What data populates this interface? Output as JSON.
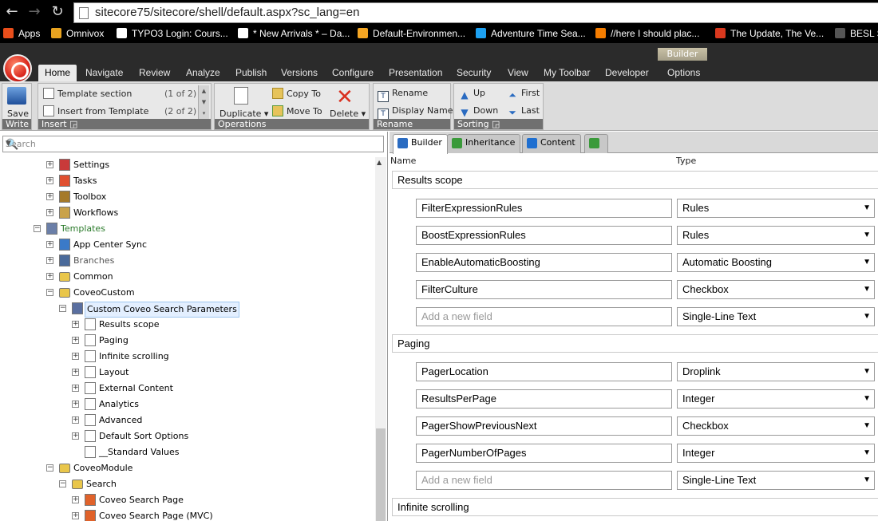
{
  "browser": {
    "url": "sitecore75/sitecore/shell/default.aspx?sc_lang=en",
    "bookmarks": [
      {
        "label": "Apps",
        "color": "#e94e1b"
      },
      {
        "label": "Omnivox",
        "color": "#e8a320"
      },
      {
        "label": "TYPO3 Login: Cours...",
        "color": "#ffffff"
      },
      {
        "label": "* New Arrivals * – Da...",
        "color": "#ffffff"
      },
      {
        "label": "Default-Environmen...",
        "color": "#f5a623"
      },
      {
        "label": "Adventure Time Sea...",
        "color": "#1da1f2"
      },
      {
        "label": "//here I should plac...",
        "color": "#f57d00"
      },
      {
        "label": "The Update, The Ve...",
        "color": "#d9381e"
      },
      {
        "label": "BESL S",
        "color": "#555555"
      }
    ]
  },
  "ribbon": {
    "context_tab": "Builder",
    "tabs": [
      "Home",
      "Navigate",
      "Review",
      "Analyze",
      "Publish",
      "Versions",
      "Configure",
      "Presentation",
      "Security",
      "View",
      "My Toolbar",
      "Developer",
      "Options"
    ],
    "groups": {
      "write": {
        "label": "Write",
        "save": "Save"
      },
      "insert": {
        "label": "Insert",
        "items": [
          {
            "label": "Template section",
            "count": "(1 of 2)"
          },
          {
            "label": "Insert from Template",
            "count": "(2 of 2)"
          }
        ]
      },
      "operations": {
        "label": "Operations",
        "duplicate": "Duplicate",
        "copy_to": "Copy To",
        "move_to": "Move To",
        "delete": "Delete"
      },
      "rename": {
        "label": "Rename",
        "rename": "Rename",
        "display_name": "Display Name"
      },
      "sorting": {
        "label": "Sorting",
        "up": "Up",
        "down": "Down",
        "first": "First",
        "last": "Last"
      }
    }
  },
  "tree": {
    "search_placeholder": "Search",
    "items": [
      {
        "label": "Settings",
        "level": 0,
        "expander": "+",
        "icon": "settings-icon"
      },
      {
        "label": "Tasks",
        "level": 0,
        "expander": "+",
        "icon": "tasks-icon"
      },
      {
        "label": "Toolbox",
        "level": 0,
        "expander": "+",
        "icon": "toolbox-icon"
      },
      {
        "label": "Workflows",
        "level": 0,
        "expander": "+",
        "icon": "workflows-icon"
      },
      {
        "label": "Templates",
        "level": -1,
        "expander": "−",
        "icon": "templates-icon"
      },
      {
        "label": "App Center Sync",
        "level": 0,
        "expander": "+",
        "icon": "sync-icon"
      },
      {
        "label": "Branches",
        "level": 0,
        "expander": "+",
        "icon": "branches-icon"
      },
      {
        "label": "Common",
        "level": 0,
        "expander": "+",
        "icon": "folder-icon"
      },
      {
        "label": "CoveoCustom",
        "level": 0,
        "expander": "−",
        "icon": "folder-icon"
      },
      {
        "label": "Custom Coveo Search Parameters",
        "level": 1,
        "expander": "−",
        "icon": "template-icon",
        "selected": true
      },
      {
        "label": "Results scope",
        "level": 2,
        "expander": "+",
        "icon": "section-icon"
      },
      {
        "label": "Paging",
        "level": 2,
        "expander": "+",
        "icon": "section-icon"
      },
      {
        "label": "Infinite scrolling",
        "level": 2,
        "expander": "+",
        "icon": "section-icon"
      },
      {
        "label": "Layout",
        "level": 2,
        "expander": "+",
        "icon": "section-icon"
      },
      {
        "label": "External Content",
        "level": 2,
        "expander": "+",
        "icon": "section-icon"
      },
      {
        "label": "Analytics",
        "level": 2,
        "expander": "+",
        "icon": "section-icon"
      },
      {
        "label": "Advanced",
        "level": 2,
        "expander": "+",
        "icon": "section-icon"
      },
      {
        "label": "Default Sort Options",
        "level": 2,
        "expander": "+",
        "icon": "section-icon"
      },
      {
        "label": "__Standard Values",
        "level": 2,
        "expander": "",
        "icon": "section-icon"
      },
      {
        "label": "CoveoModule",
        "level": 0,
        "expander": "−",
        "icon": "folder-icon"
      },
      {
        "label": "Search",
        "level": 1,
        "expander": "−",
        "icon": "folder-icon"
      },
      {
        "label": "Coveo Search Page",
        "level": 2,
        "expander": "+",
        "icon": "coveo-page-icon"
      },
      {
        "label": "Coveo Search Page (MVC)",
        "level": 2,
        "expander": "+",
        "icon": "coveo-page-icon"
      }
    ]
  },
  "editor": {
    "tabs": [
      {
        "label": "Builder",
        "icon": "builder-icon"
      },
      {
        "label": "Inheritance",
        "icon": "inheritance-icon"
      },
      {
        "label": "Content",
        "icon": "content-icon"
      },
      {
        "label": "",
        "icon": "add-tab-icon"
      }
    ],
    "col_name": "Name",
    "col_type": "Type",
    "sections": [
      {
        "name": "Results scope",
        "fields": [
          {
            "name": "FilterExpressionRules",
            "type": "Rules"
          },
          {
            "name": "BoostExpressionRules",
            "type": "Rules"
          },
          {
            "name": "EnableAutomaticBoosting",
            "type": "Automatic Boosting"
          },
          {
            "name": "FilterCulture",
            "type": "Checkbox"
          }
        ],
        "new_field": {
          "placeholder": "Add a new field",
          "type": "Single-Line Text"
        }
      },
      {
        "name": "Paging",
        "fields": [
          {
            "name": "PagerLocation",
            "type": "Droplink"
          },
          {
            "name": "ResultsPerPage",
            "type": "Integer"
          },
          {
            "name": "PagerShowPreviousNext",
            "type": "Checkbox"
          },
          {
            "name": "PagerNumberOfPages",
            "type": "Integer"
          }
        ],
        "new_field": {
          "placeholder": "Add a new field",
          "type": "Single-Line Text"
        }
      },
      {
        "name": "Infinite scrolling",
        "fields": []
      }
    ]
  }
}
